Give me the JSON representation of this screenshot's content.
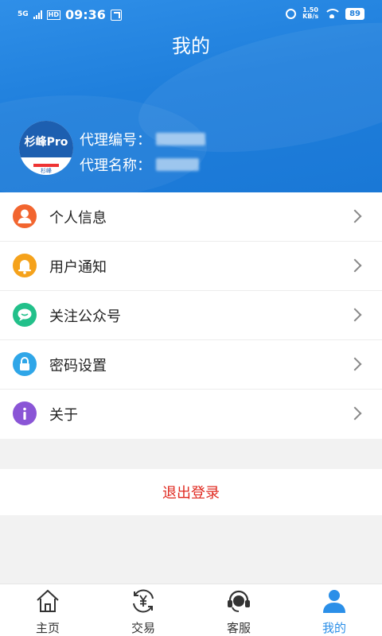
{
  "statusbar": {
    "network": "5G",
    "hd": "HD",
    "time": "09:36",
    "speed_value": "1.50",
    "speed_unit": "KB/s",
    "battery": "89"
  },
  "header": {
    "title": "我的",
    "avatar_logo": "杉峰Pro",
    "avatar_small": "杉峰",
    "agent_id_label": "代理编号：",
    "agent_name_label": "代理名称："
  },
  "menu": {
    "items": [
      {
        "label": "个人信息",
        "icon": "person-icon",
        "color": "#f2652f"
      },
      {
        "label": "用户通知",
        "icon": "bell-icon",
        "color": "#f5a21b"
      },
      {
        "label": "关注公众号",
        "icon": "chat-icon",
        "color": "#22c08a"
      },
      {
        "label": "密码设置",
        "icon": "lock-icon",
        "color": "#2fa6e8"
      },
      {
        "label": "关于",
        "icon": "info-icon",
        "color": "#8a55d6"
      }
    ]
  },
  "logout_label": "退出登录",
  "tabbar": {
    "tabs": [
      {
        "label": "主页",
        "icon": "home-icon"
      },
      {
        "label": "交易",
        "icon": "yuan-exchange-icon"
      },
      {
        "label": "客服",
        "icon": "headset-icon"
      },
      {
        "label": "我的",
        "icon": "user-icon",
        "active": true
      }
    ]
  },
  "colors": {
    "accent": "#2b8fe8",
    "logout": "#e02a20"
  }
}
